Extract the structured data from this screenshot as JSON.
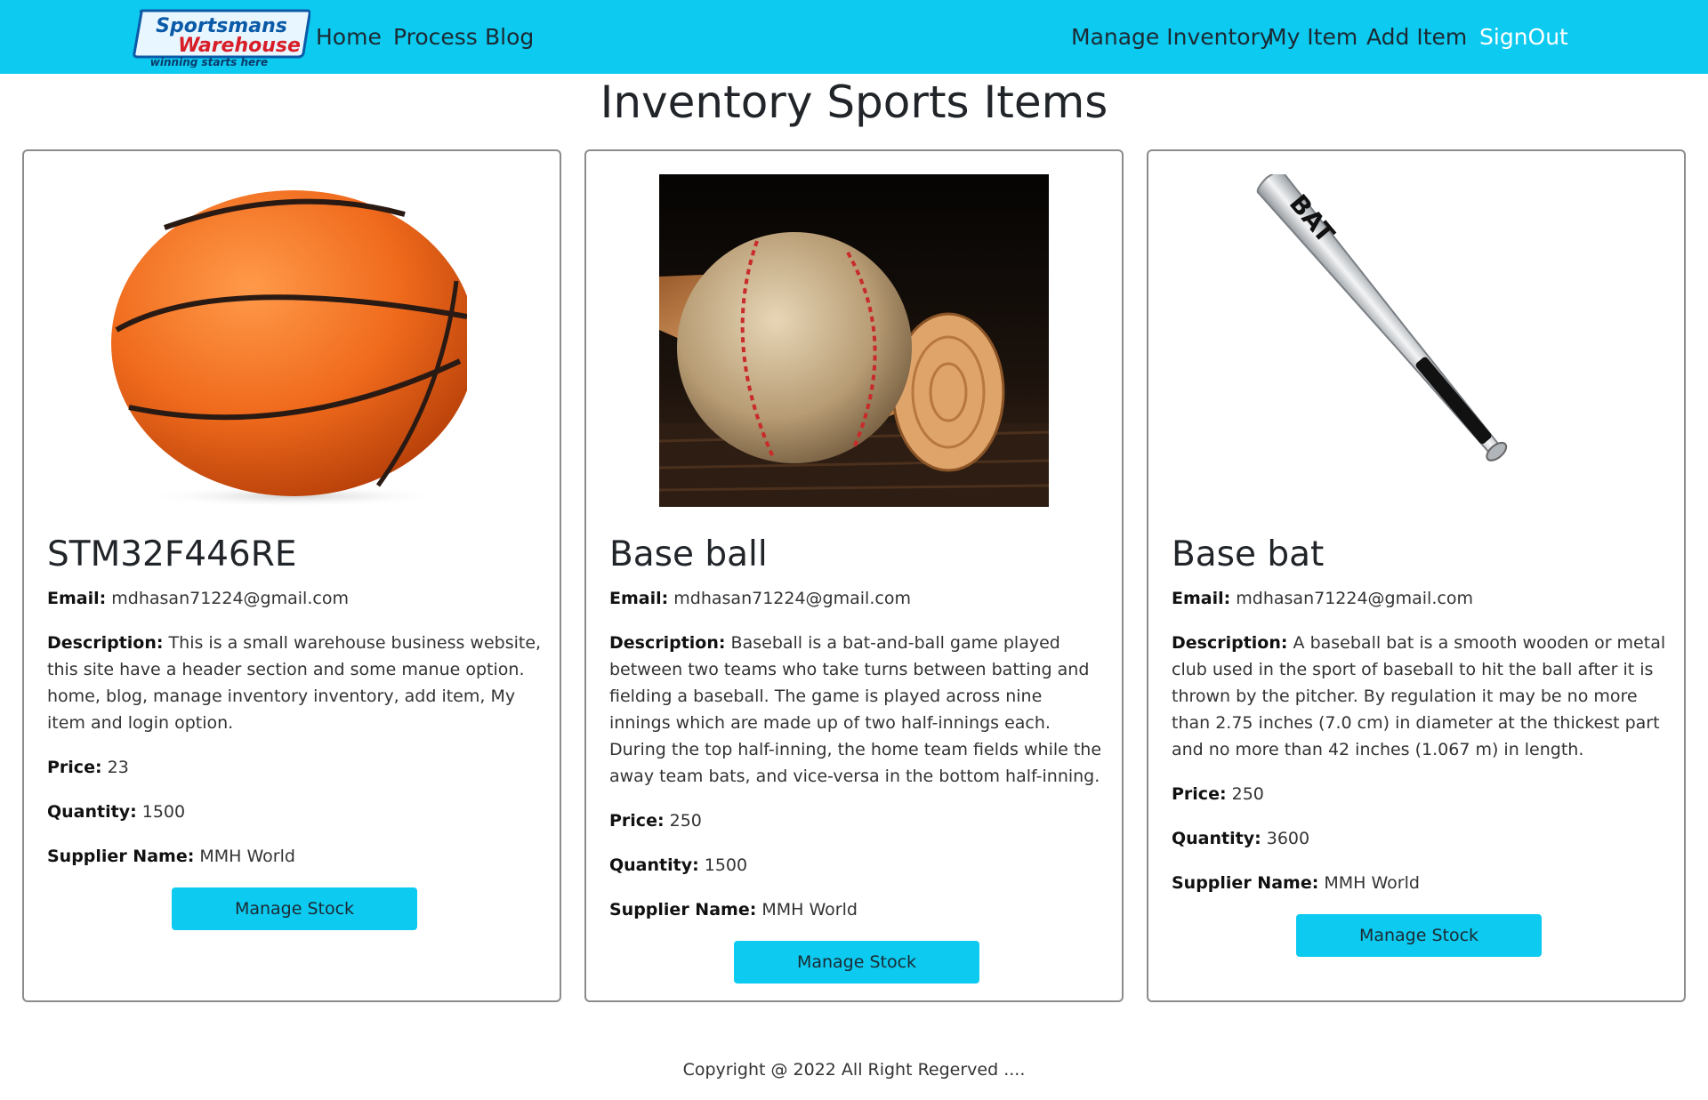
{
  "brand": {
    "line1": "Sportsmans",
    "line2": "Warehouse",
    "tagline": "winning starts here"
  },
  "nav": {
    "left": [
      "Home",
      "Process",
      "Blog"
    ],
    "right": [
      "Manage Inventory",
      "My Item",
      "Add Item"
    ],
    "signout": "SignOut"
  },
  "page_title": "Inventory Sports Items",
  "labels": {
    "email": "Email:",
    "description": "Description:",
    "price": "Price:",
    "quantity": "Quantity:",
    "supplier": "Supplier Name:",
    "button": "Manage Stock"
  },
  "items": [
    {
      "name": "STM32F446RE",
      "image": "basketball",
      "email": "mdhasan71224@gmail.com",
      "description": "This is a small warehouse business website, this site have a header section and some manue option. home, blog, manage inventory inventory, add item, My item and login option.",
      "price": "23",
      "quantity": "1500",
      "supplier": "MMH World"
    },
    {
      "name": "Base ball",
      "image": "baseball",
      "email": "mdhasan71224@gmail.com",
      "description": "Baseball is a bat-and-ball game played between two teams who take turns between batting and fielding a baseball. The game is played across nine innings which are made up of two half-innings each. During the top half-inning, the home team fields while the away team bats, and vice-versa in the bottom half-inning.",
      "price": "250",
      "quantity": "1500",
      "supplier": "MMH World"
    },
    {
      "name": "Base bat",
      "image": "baseball-bat",
      "email": "mdhasan71224@gmail.com",
      "description": "A baseball bat is a smooth wooden or metal club used in the sport of baseball to hit the ball after it is thrown by the pitcher. By regulation it may be no more than 2.75 inches (7.0 cm) in diameter at the thickest part and no more than 42 inches (1.067 m) in length.",
      "price": "250",
      "quantity": "3600",
      "supplier": "MMH World"
    }
  ],
  "footer": "Copyright @ 2022 All Right Regerved ....",
  "colors": {
    "accent": "#0dcaf0",
    "text": "#212529",
    "border": "#8c8c8c"
  }
}
